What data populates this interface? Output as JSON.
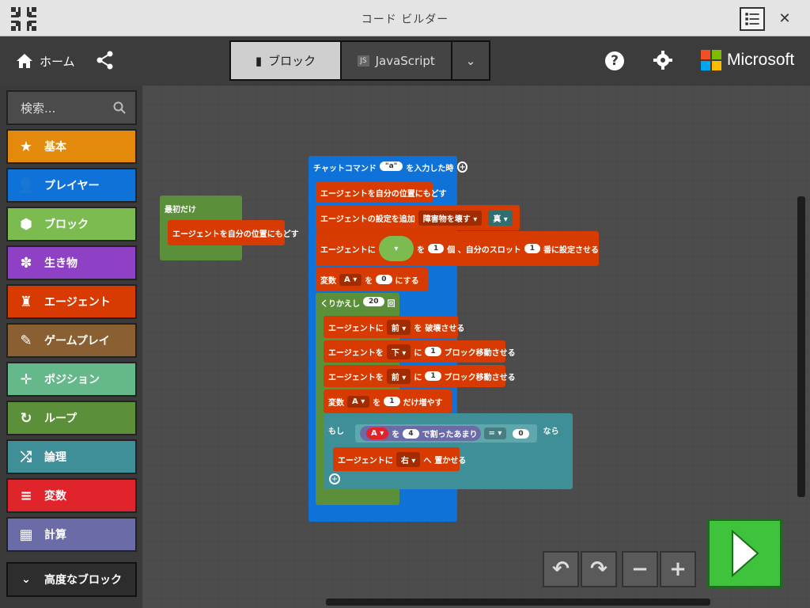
{
  "window": {
    "title": "コード ビルダー"
  },
  "header": {
    "home_label": "ホーム",
    "tabs": [
      {
        "label": "ブロック",
        "active": true
      },
      {
        "label": "JavaScript",
        "active": false
      }
    ],
    "brand": "Microsoft"
  },
  "sidebar": {
    "search_placeholder": "検索...",
    "categories": [
      {
        "label": "基本",
        "color": "#e38a0c",
        "icon": "star-icon"
      },
      {
        "label": "プレイヤー",
        "color": "#0f72d8",
        "icon": "person-icon"
      },
      {
        "label": "ブロック",
        "color": "#7cbb4f",
        "icon": "cube-icon"
      },
      {
        "label": "生き物",
        "color": "#8f41c6",
        "icon": "paw-icon"
      },
      {
        "label": "エージェント",
        "color": "#d83b01",
        "icon": "agent-icon"
      },
      {
        "label": "ゲームプレイ",
        "color": "#8a5f32",
        "icon": "wrench-icon"
      },
      {
        "label": "ポジション",
        "color": "#64b88a",
        "icon": "crosshair-icon"
      },
      {
        "label": "ループ",
        "color": "#5b8f3a",
        "icon": "loop-icon"
      },
      {
        "label": "論理",
        "color": "#3e8f97",
        "icon": "shuffle-icon"
      },
      {
        "label": "変数",
        "color": "#e0242b",
        "icon": "list-icon"
      },
      {
        "label": "計算",
        "color": "#6b6ba8",
        "icon": "calculator-icon"
      }
    ],
    "advanced_label": "高度なブロック"
  },
  "workspace": {
    "first_block": {
      "label": "最初だけ",
      "inner": "エージェントを自分の位置にもどす"
    },
    "chat": {
      "prefix": "チャットコマンド",
      "cmd": "\"a\"",
      "suffix": "を入力した時"
    },
    "b1": "エージェントを自分の位置にもどす",
    "b2": {
      "text": "エージェントの設定を追加",
      "opt": "障害物を壊す ▾",
      "val": "真 ▾"
    },
    "b3": {
      "a": "エージェントに",
      "b": "を",
      "n1": "1",
      "c": "個 、自分のスロット",
      "n2": "1",
      "d": "番に設定させる"
    },
    "b4": {
      "a": "変数",
      "var": "A ▾",
      "b": "を",
      "n": "0",
      "c": "にする"
    },
    "loop": {
      "a": "くりかえし",
      "n": "20",
      "b": "回"
    },
    "l1": {
      "a": "エージェントに",
      "opt": "前 ▾",
      "b": "を",
      "c": "破壊させる"
    },
    "l2": {
      "a": "エージェントを",
      "opt": "下 ▾",
      "b": "に",
      "n": "1",
      "c": "ブロック移動させる"
    },
    "l3": {
      "a": "エージェントを",
      "opt": "前 ▾",
      "b": "に",
      "n": "1",
      "c": "ブロック移動させる"
    },
    "l4": {
      "a": "変数",
      "var": "A ▾",
      "b": "を",
      "n": "1",
      "c": "だけ増やす"
    },
    "if": {
      "a": "もし",
      "var": "A ▾",
      "b": "を",
      "n": "4",
      "c": "で割ったあまり",
      "op": "= ▾",
      "v": "0",
      "d": "なら"
    },
    "i1": {
      "a": "エージェントに",
      "opt": "右 ▾",
      "b": "へ",
      "c": "置かせる"
    }
  }
}
